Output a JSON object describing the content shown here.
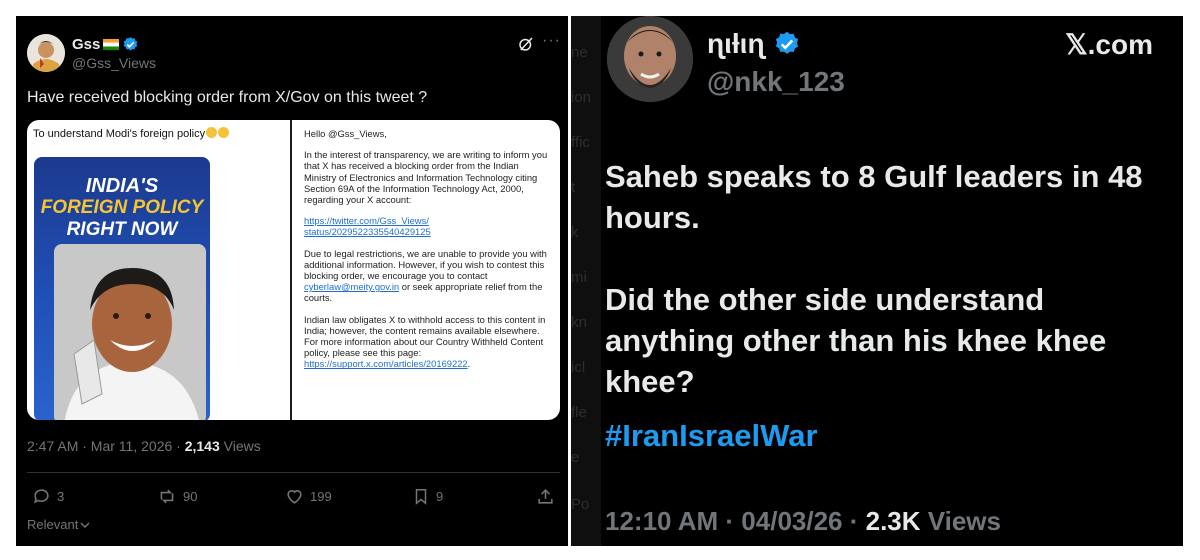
{
  "left_tweet": {
    "display_name": "Gss",
    "handle": "@Gss_Views",
    "more": "···",
    "text": "Have received blocking order from X/Gov on this tweet ?",
    "card": {
      "caption": "To understand Modi's foreign policy",
      "promo_line1": "INDIA'S",
      "promo_line2": "FOREIGN POLICY",
      "promo_line3": "RIGHT NOW",
      "notice": {
        "greeting": "Hello @Gss_Views,",
        "para1": "In the interest of transparency, we are writing to inform you that X has received a blocking order from the Indian Ministry of Electronics and Information Technology citing Section 69A of the Information Technology Act, 2000, regarding your X account:",
        "tweet_link_line1": "https://twitter.com/Gss_Views/",
        "tweet_link_line2": "status/2029522335540429125",
        "para2_a": "Due to legal restrictions, we are unable to provide you with additional information. However, if you wish to contest this blocking order, we encourage you to contact ",
        "email": "cyberlaw@meity.gov.in",
        "para2_b": " or seek appropriate relief from the courts.",
        "para3": "Indian law obligates X to withhold access to this content in India; however, the content remains available elsewhere. For more information about our Country Withheld Content policy, please see this page:",
        "policy_link": "https://support.x.com/articles/20169222",
        "policy_end": "."
      }
    },
    "meta_time": "2:47 AM · Mar 11, 2026 · ",
    "views_count": "2,143",
    "views_label": " Views",
    "replies": "3",
    "reposts": "90",
    "likes": "199",
    "bookmarks": "9",
    "relevant": "Relevant"
  },
  "right_tweet": {
    "display_name": "ɳιƚιɳ",
    "handle": "@nkk_123",
    "site": "𝕏.com",
    "text_p1": "Saheb speaks to 8 Gulf leaders in 48 hours.",
    "text_p2": "Did the other side understand anything other than his khee khee khee?",
    "hashtag": "#IranIsraelWar",
    "meta_time": "12:10 AM · 04/03/26 · ",
    "views_count": "2.3K",
    "views_label": " Views",
    "ghost_fragments": [
      "ne",
      "ion",
      "ffic",
      "t",
      "k",
      "mi",
      "kn",
      "icl",
      "fle",
      "e",
      "Po"
    ]
  },
  "colors": {
    "background": "#000000",
    "text": "#e7e9ea",
    "muted": "#71767b",
    "accent_blue": "#1d9bf0",
    "separator": "#2f3336"
  },
  "icons": [
    "verified-badge-icon",
    "india-flag-icon",
    "grok-icon",
    "more-icon",
    "reply-icon",
    "repost-icon",
    "like-icon",
    "bookmark-icon",
    "share-icon",
    "chevron-down-icon"
  ]
}
